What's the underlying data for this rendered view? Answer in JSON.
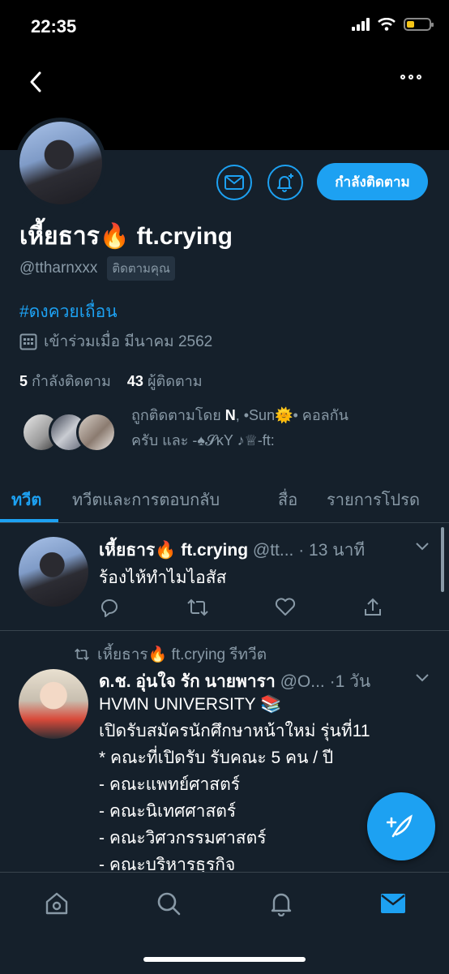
{
  "status": {
    "time": "22:35"
  },
  "profile": {
    "name": "เหี้ยธาร🔥 ft.crying",
    "handle": "@ttharnxxx",
    "follows_you": "ติดตามคุณ",
    "follow_button": "กำลังติดตาม",
    "hashtag": "#ดงควยเถื่อน",
    "joined": "เข้าร่วมเมื่อ มีนาคม 2562",
    "following_count": "5",
    "following_label": "กำลังติดตาม",
    "followers_count": "43",
    "followers_label": "ผู้ติดตาม",
    "followed_by_prefix": "ถูกติดตามโดย ",
    "followed_by_n": "N",
    "followed_by_rest": ", •Sun🌞• คอลกัน",
    "followed_by_line2": "ครับ และ -♠𝓢ᴋY ♪♕-ft:"
  },
  "tabs": [
    "ทวีต",
    "ทวีตและการตอบกลับ",
    "สื่อ",
    "รายการโปรด"
  ],
  "tweets": [
    {
      "name": "เหี้ยธาร🔥 ft.crying",
      "handle": "@tt...",
      "time": "· 13 นาที",
      "text": "ร้องไห้ทำไมไอสัส"
    },
    {
      "retweet_label": "เหี้ยธาร🔥 ft.crying รีทวีต",
      "name": "ด.ช. อุ่นใจ รัก นายพารา",
      "handle": "@O...",
      "time": "·1 วัน",
      "lines": [
        "HVMN UNIVERSITY 📚",
        "เปิดรับสมัครนักศึกษาหน้าใหม่ รุ่นที่11",
        "* คณะที่เปิดรับ รับคณะ 5 คน / ปี",
        "- คณะแพทย์ศาสตร์",
        "- คณะนิเทศศาสตร์",
        "- คณะวิศวกรรมศาสตร์",
        "- คณะบริหารธุรกิจ"
      ]
    }
  ],
  "colors": {
    "accent": "#1da1f2",
    "background": "#15202b",
    "muted": "#8899a6",
    "divider": "#38444d"
  }
}
